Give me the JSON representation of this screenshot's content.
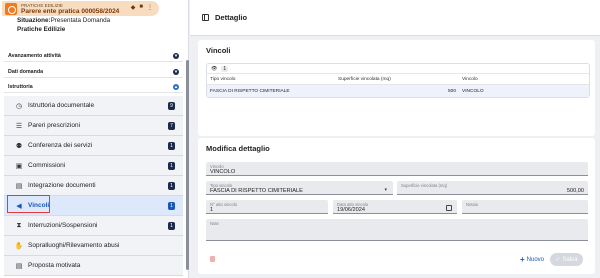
{
  "banner": {
    "subtitle": "PRATICHE EDILIZIE",
    "title": "Parere ente pratica 000058/2024"
  },
  "info": {
    "situazione_label": "Situazione:",
    "situazione_value": "Presentata Domanda",
    "category": "Pratiche Edilizie"
  },
  "sections": {
    "avanzamento": "Avanzamento attività",
    "dati_domanda": "Dati domanda",
    "istruttoria": "Istruttoria"
  },
  "menu": [
    {
      "label": "Istruttoria documentale",
      "badge": "9",
      "icon": "clock-doc-icon"
    },
    {
      "label": "Pareri prescrizioni",
      "badge": "7",
      "icon": "list-icon"
    },
    {
      "label": "Conferenza dei servizi",
      "badge": "1",
      "icon": "people-icon"
    },
    {
      "label": "Commissioni",
      "badge": "1",
      "icon": "briefcase-icon"
    },
    {
      "label": "Integrazione documenti",
      "badge": "1",
      "icon": "document-icon"
    },
    {
      "label": "Vincoli",
      "badge": "1",
      "icon": "megaphone-icon"
    },
    {
      "label": "Interruzioni/Sospensioni",
      "badge": "1",
      "icon": "hourglass-icon"
    },
    {
      "label": "Sopralluoghi/Rilevamento abusi",
      "badge": "",
      "icon": "handshake-icon"
    },
    {
      "label": "Proposta motivata",
      "badge": "",
      "icon": "document-icon"
    }
  ],
  "detail": {
    "header": "Dettaglio",
    "vincoli_title": "Vincoli",
    "count": "1",
    "columns": [
      "Tipo vincolo",
      "Superficie vincolata (mq)",
      "Vincolo"
    ],
    "rows": [
      [
        "FASCIA DI RISPETTO CIMITERIALE",
        "500",
        "VINCOLO"
      ]
    ]
  },
  "form": {
    "title": "Modifica dettaglio",
    "vincolo_label": "Vincolo",
    "vincolo_value": "VINCOLO",
    "tipo_label": "Tipo vincolo",
    "tipo_value": "FASCIA DI RISPETTO CIMITERIALE",
    "sup_label": "Superficie vincolata (mq)",
    "sup_value": "500,00",
    "atto_label": "N° atto vincolo",
    "atto_value": "1",
    "data_label": "Data atto vincolo",
    "data_value": "19/06/2024",
    "notaio_label": "Notaio",
    "notaio_value": "",
    "note_label": "Note",
    "note_value": ""
  },
  "buttons": {
    "nuovo": "Nuovo",
    "salva": "Salva"
  },
  "colors": {
    "accent": "#1a56b8",
    "brand_orange": "#f07a20",
    "highlight": "#e23b3b"
  }
}
